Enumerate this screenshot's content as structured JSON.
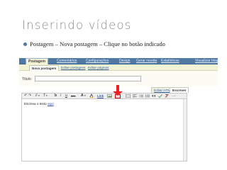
{
  "slide": {
    "title": "Inserindo vídeos",
    "bullet": "Postagem – Nova postagem – Clique no botão indicado"
  },
  "blogger": {
    "nav_tabs": [
      {
        "label": "Postagem"
      },
      {
        "label": "Comentários"
      },
      {
        "label": "Configurações"
      },
      {
        "label": "Design"
      },
      {
        "label": "Gerar receita"
      },
      {
        "label": "Estatísticas"
      }
    ],
    "view_blog": "Visualizar blog",
    "sub_tabs": [
      {
        "label": "Nova postagem"
      },
      {
        "label": "Editar postagens"
      },
      {
        "label": "Editar páginas"
      }
    ],
    "title_label": "Título:",
    "mode_html": "Editar HTML",
    "mode_compose": "Escrever",
    "toolbar": {
      "undo": "↶",
      "redo": "↷",
      "font": "F",
      "size": "T",
      "bold": "b",
      "italic": "i",
      "underline": "u",
      "strike": "abc",
      "color": "A",
      "link": "Link",
      "more": "…"
    },
    "editor_text": "Escreva o texto ",
    "editor_link": "aqui",
    "accent_red": "#ee1f1f",
    "nav_blue": "#4f79a2"
  }
}
